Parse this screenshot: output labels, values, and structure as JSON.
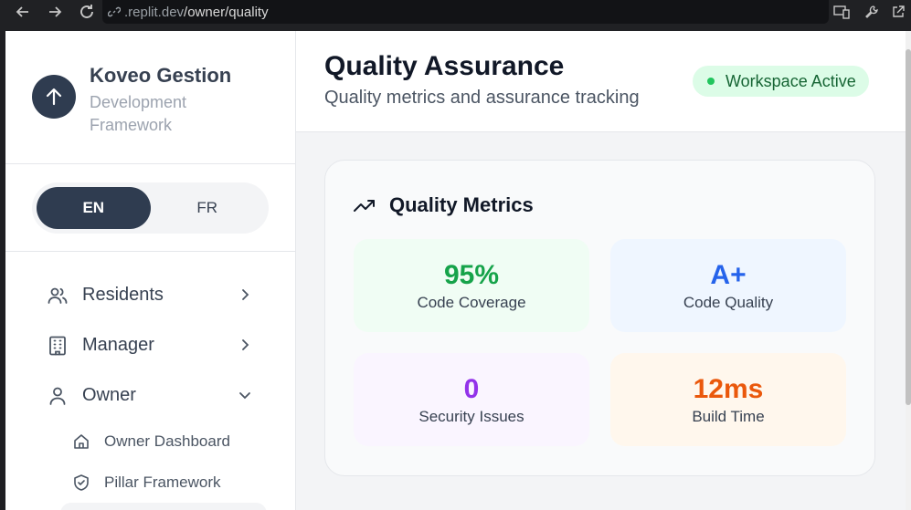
{
  "browser": {
    "url_host": ".replit.dev",
    "url_path": "/owner/quality"
  },
  "brand": {
    "title": "Koveo Gestion",
    "subtitle": "Development Framework"
  },
  "language": {
    "options": [
      "EN",
      "FR"
    ],
    "selected": "EN"
  },
  "nav": {
    "items": [
      {
        "label": "Residents",
        "icon": "users-icon",
        "expanded": false
      },
      {
        "label": "Manager",
        "icon": "building-icon",
        "expanded": false
      },
      {
        "label": "Owner",
        "icon": "user-icon",
        "expanded": true
      }
    ],
    "sub_items": [
      {
        "label": "Owner Dashboard",
        "icon": "home-icon"
      },
      {
        "label": "Pillar Framework",
        "icon": "shield-icon"
      }
    ]
  },
  "header": {
    "title": "Quality Assurance",
    "subtitle": "Quality metrics and assurance tracking",
    "badge": "Workspace Active"
  },
  "quality": {
    "title": "Quality Metrics",
    "metrics": [
      {
        "value": "95%",
        "label": "Code Coverage",
        "color": "#16a34a",
        "bg": "#f0fdf4"
      },
      {
        "value": "A+",
        "label": "Code Quality",
        "color": "#2563eb",
        "bg": "#eff6ff"
      },
      {
        "value": "0",
        "label": "Security Issues",
        "color": "#9333ea",
        "bg": "#faf5ff"
      },
      {
        "value": "12ms",
        "label": "Build Time",
        "color": "#ea580c",
        "bg": "#fff7ed"
      }
    ]
  },
  "colors": {
    "sidebar_dark": "#2f3c50",
    "badge_bg": "#dcfce7",
    "badge_text": "#166534"
  }
}
